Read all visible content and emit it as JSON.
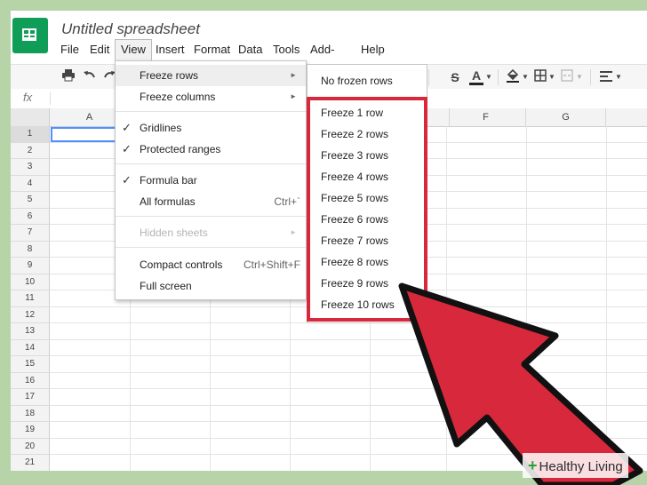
{
  "app": {
    "title": "Untitled spreadsheet",
    "colors": {
      "brand": "#0f9d58",
      "highlight": "#d8283c",
      "selection": "#4d90fe"
    }
  },
  "menubar": {
    "items": [
      "File",
      "Edit",
      "View",
      "Insert",
      "Format",
      "Data",
      "Tools",
      "Add-ons",
      "Help"
    ],
    "active": "View"
  },
  "toolbar": {
    "icons": [
      "print-icon",
      "undo-icon",
      "redo-icon",
      "strikethrough-icon",
      "text-color-icon",
      "fill-color-icon",
      "borders-icon",
      "merge-icon",
      "align-icon"
    ],
    "strike_glyph": "S",
    "text_color_glyph": "A"
  },
  "formula_bar": {
    "label": "fx"
  },
  "grid": {
    "columns": [
      "A",
      "F",
      "G"
    ],
    "rows": [
      "1",
      "2",
      "3",
      "4",
      "5",
      "6",
      "7",
      "8",
      "9",
      "10",
      "11",
      "12",
      "13",
      "14",
      "15",
      "16",
      "17",
      "18",
      "19",
      "20",
      "21"
    ],
    "selected_row": "1"
  },
  "view_menu": {
    "freeze_rows": "Freeze rows",
    "freeze_columns": "Freeze columns",
    "gridlines": "Gridlines",
    "protected_ranges": "Protected ranges",
    "formula_bar": "Formula bar",
    "all_formulas": "All formulas",
    "all_formulas_shortcut": "Ctrl+`",
    "hidden_sheets": "Hidden sheets",
    "compact_controls": "Compact controls",
    "compact_controls_shortcut": "Ctrl+Shift+F",
    "full_screen": "Full screen",
    "check_glyph": "✓",
    "arrow_glyph": "►"
  },
  "freeze_submenu": {
    "no_frozen": "No frozen rows",
    "options": [
      "Freeze 1 row",
      "Freeze 2 rows",
      "Freeze 3 rows",
      "Freeze 4 rows",
      "Freeze 5 rows",
      "Freeze 6 rows",
      "Freeze 7 rows",
      "Freeze 8 rows",
      "Freeze 9 rows",
      "Freeze 10 rows"
    ]
  },
  "watermark": {
    "plus": "+",
    "text": "Healthy Living"
  }
}
